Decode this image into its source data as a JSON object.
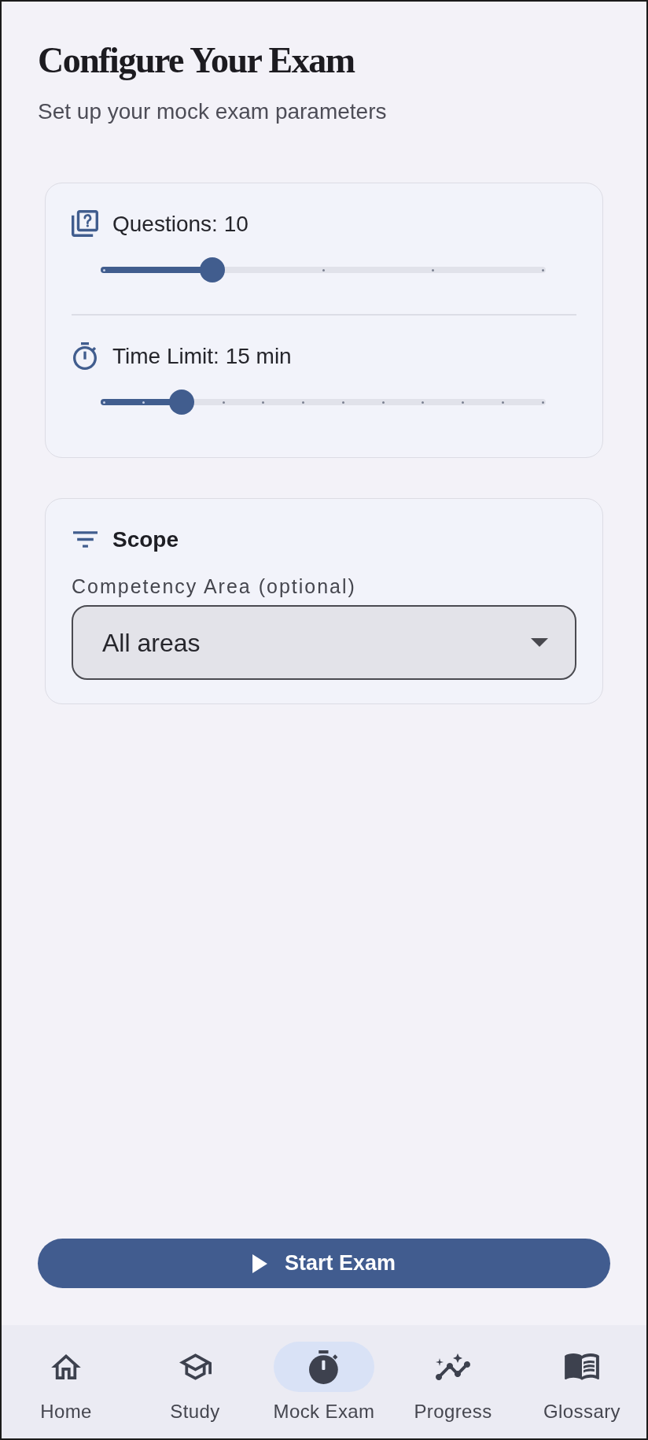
{
  "header": {
    "title": "Configure Your Exam",
    "subtitle": "Set up your mock exam parameters"
  },
  "settings_card": {
    "sliders": [
      {
        "label": "Questions: 10",
        "level": 0.25
      },
      {
        "label": "Time Limit: 15 min",
        "level": 0.1818
      }
    ]
  },
  "scope_card": {
    "title": "Scope",
    "field_label": "Competency Area (optional)",
    "dropdown": {
      "value": "All areas"
    }
  },
  "start_button": {
    "label": "Start Exam"
  },
  "nav": {
    "items": [
      {
        "label": "Home",
        "selected": false
      },
      {
        "label": "Study",
        "selected": false
      },
      {
        "label": "Mock Exam",
        "selected": true
      },
      {
        "label": "Progress",
        "selected": false
      },
      {
        "label": "Glossary",
        "selected": false
      }
    ]
  }
}
